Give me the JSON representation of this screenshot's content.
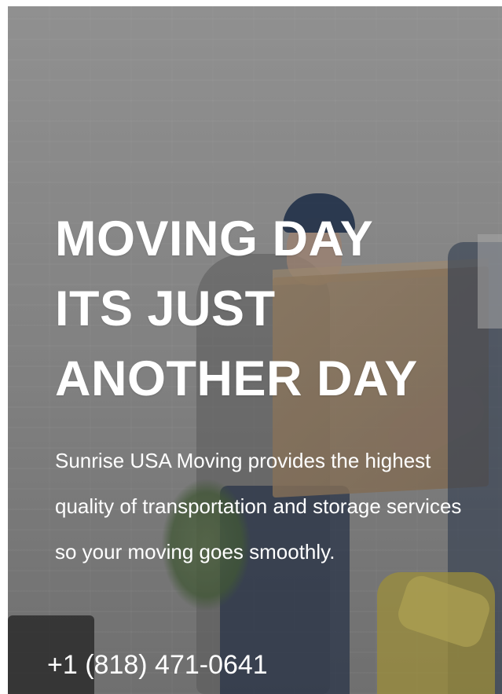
{
  "hero": {
    "headline_lines": [
      "MOVING DAY",
      "ITS JUST",
      "ANOTHER DAY"
    ],
    "description": "Sunrise USA Moving provides the highest quality of transportation and storage services so your moving goes smoothly.",
    "phone": "+1 (818) 471-0641"
  },
  "colors": {
    "text": "#ffffff",
    "overlay": "#282828"
  }
}
